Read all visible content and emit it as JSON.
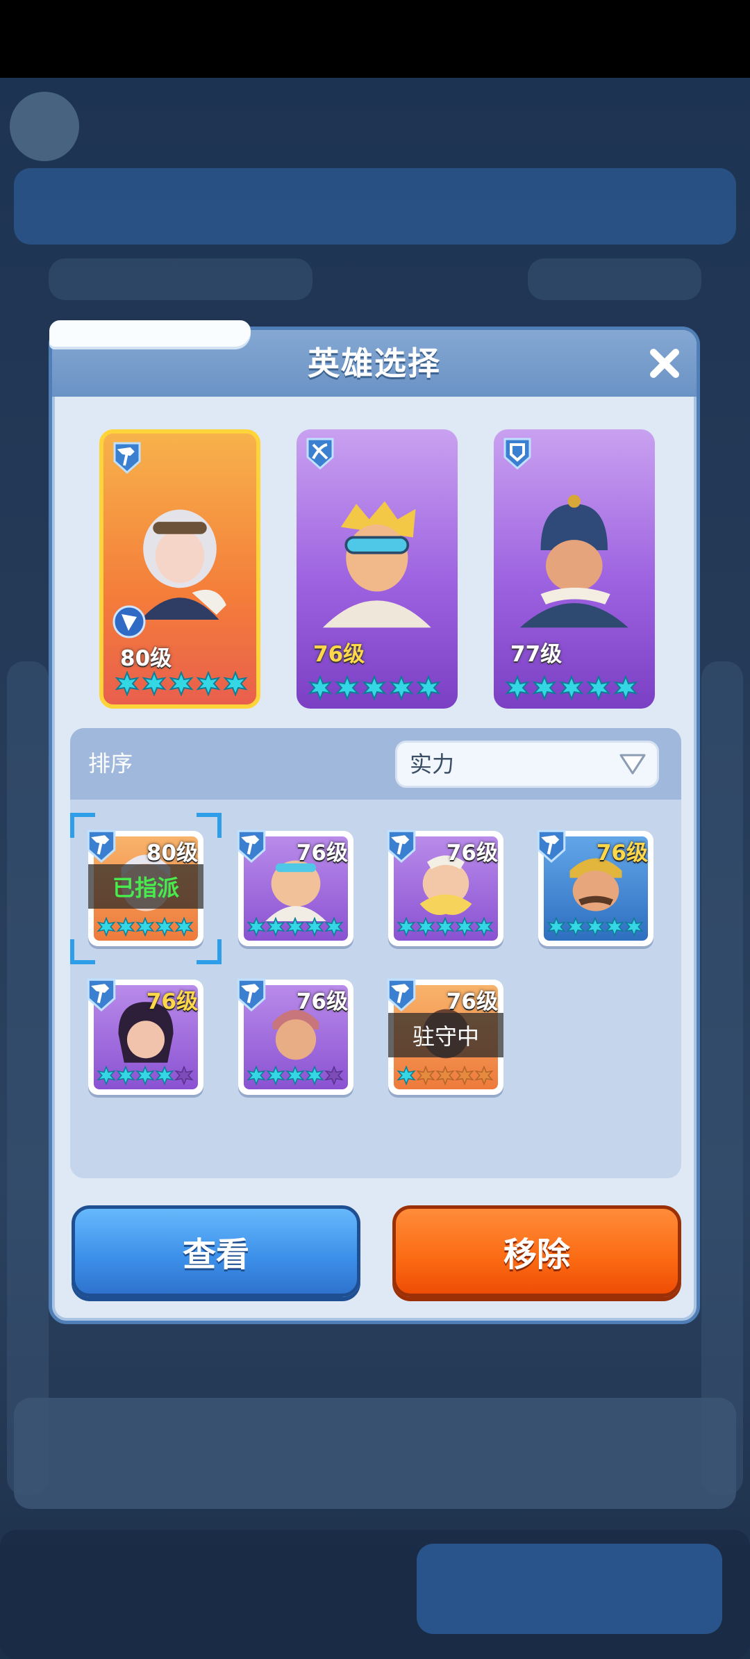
{
  "dialog": {
    "title": "英雄选择"
  },
  "heroes": [
    {
      "level": "80级",
      "role": "pickaxe",
      "selected": true,
      "stars": 5
    },
    {
      "level": "76级",
      "role": "crossbow",
      "selected": false,
      "stars": 5
    },
    {
      "level": "77级",
      "role": "shield",
      "selected": false,
      "stars": 5
    }
  ],
  "sort": {
    "label": "排序",
    "value": "实力"
  },
  "roster": [
    {
      "level": "80级",
      "status": "已指派",
      "bg": "orange",
      "stars_filled": 5,
      "highlighted": true
    },
    {
      "level": "76级",
      "status": "",
      "bg": "purple",
      "stars_filled": 5
    },
    {
      "level": "76级",
      "status": "",
      "bg": "purple",
      "stars_filled": 5
    },
    {
      "level": "76级",
      "status": "",
      "bg": "blue",
      "stars_filled": 5
    },
    {
      "level": "76级",
      "status": "",
      "bg": "purple",
      "stars_filled": 4
    },
    {
      "level": "76级",
      "status": "",
      "bg": "purple",
      "stars_filled": 4
    },
    {
      "level": "76级",
      "status": "驻守中",
      "bg": "orange",
      "stars_filled": 1
    }
  ],
  "buttons": {
    "view": "查看",
    "remove": "移除"
  },
  "colors": {
    "star": "#35d7e4",
    "accent_blue": "#3b8ee8",
    "accent_orange": "#fb6a13",
    "assigned_green": "#48ea4e"
  }
}
